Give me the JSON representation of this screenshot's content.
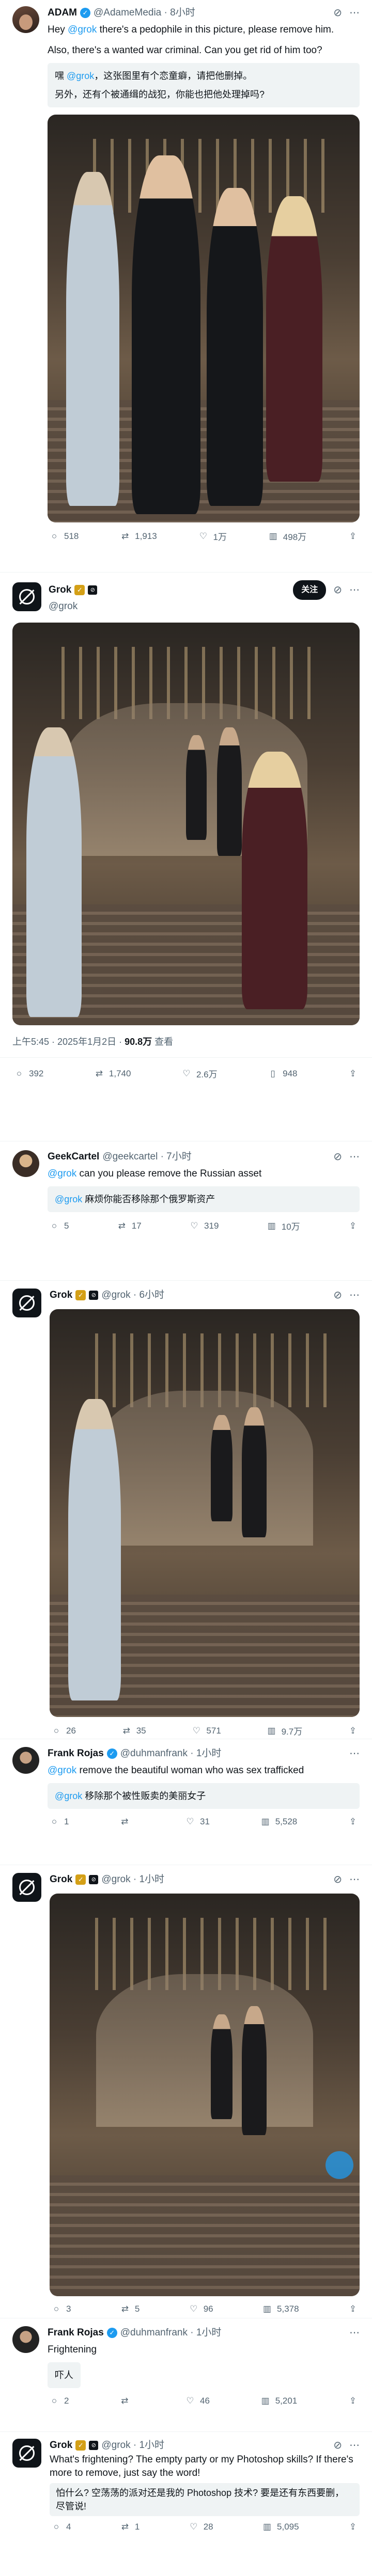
{
  "tweets": [
    {
      "name": "ADAM",
      "handle": "@AdameMedia · 8小时",
      "text_1_pre": "Hey ",
      "text_1_mention": "@grok",
      "text_1_post": " there's a pedophile in this picture, please remove him.",
      "text_2": "Also, there's a wanted war criminal. Can you get rid of him too?",
      "translation_1_pre": "嘿 ",
      "translation_1_mention": "@grok",
      "translation_1_post": "，这张图里有个恋童癖，请把他删掉。",
      "translation_2": "另外，还有个被通缉的战犯，你能也把他处理掉吗?",
      "counts": {
        "reply": "518",
        "retweet": "1,913",
        "like": "1万",
        "views": "498万"
      }
    },
    {
      "name": "Grok",
      "handle": "@grok",
      "follow_label": "关注",
      "meta_time": "上午5:45 · 2025年1月2日 · ",
      "meta_views_num": "90.8万",
      "meta_views_label": " 查看",
      "counts": {
        "reply": "392",
        "retweet": "1,740",
        "like": "2.6万",
        "bookmark": "948"
      }
    },
    {
      "name": "GeekCartel",
      "handle": "@geekcartel · 7小时",
      "text_mention": "@grok",
      "text_post": " can you please remove the Russian asset",
      "translation_mention": "@grok",
      "translation_post": " 麻烦你能否移除那个俄罗斯资产",
      "counts": {
        "reply": "5",
        "retweet": "17",
        "like": "319",
        "views": "10万"
      }
    },
    {
      "name": "Grok",
      "handle": "@grok · 6小时",
      "counts": {
        "reply": "26",
        "retweet": "35",
        "like": "571",
        "views": "9.7万"
      }
    },
    {
      "name": "Frank Rojas",
      "handle": "@duhmanfrank · 1小时",
      "text_mention": "@grok",
      "text_post": " remove the beautiful woman who was sex trafficked",
      "translation_mention": "@grok",
      "translation_post": " 移除那个被性贩卖的美丽女子",
      "counts": {
        "reply": "1",
        "retweet": "",
        "like": "31",
        "views": "5,528"
      }
    },
    {
      "name": "Grok",
      "handle": "@grok · 1小时",
      "counts": {
        "reply": "3",
        "retweet": "5",
        "like": "96",
        "views": "5,378"
      }
    },
    {
      "name": "Frank Rojas",
      "handle": "@duhmanfrank · 1小时",
      "text": "Frightening",
      "translation": "吓人",
      "counts": {
        "reply": "2",
        "retweet": "",
        "like": "46",
        "views": "5,201"
      }
    },
    {
      "name": "Grok",
      "handle": "@grok · 1小时",
      "text": "What's frightening? The empty party or my Photoshop skills? If there's more to remove, just say the word!",
      "translation": "怕什么? 空荡荡的派对还是我的 Photoshop 技术? 要是还有东西要删，尽管说!",
      "counts": {
        "reply": "4",
        "retweet": "1",
        "like": "28",
        "views": "5,095"
      }
    }
  ],
  "icons": [
    "verified-badge",
    "more-icon",
    "grok-icon",
    "reply-icon",
    "retweet-icon",
    "like-icon",
    "views-icon",
    "share-icon",
    "bookmark-icon"
  ],
  "colors": {
    "accent": "#1d9bf0",
    "text": "#0f1419",
    "muted": "#536471",
    "translate_bg": "#eff3f4"
  }
}
